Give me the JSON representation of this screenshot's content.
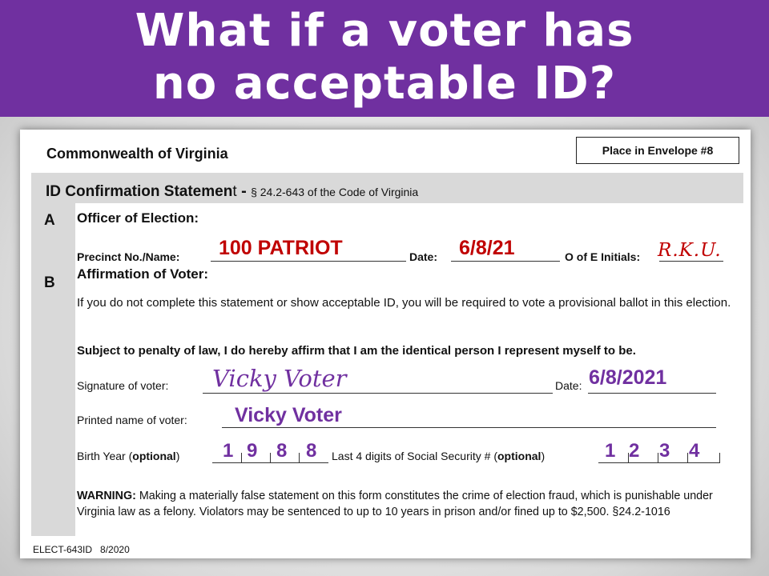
{
  "slide": {
    "title": "What if a voter has\nno acceptable ID?",
    "colors": {
      "banner": "#7030a0",
      "red_entry": "#c00000",
      "purple_entry": "#7030a0"
    }
  },
  "form": {
    "organization": "Commonwealth of Virginia",
    "envelope_label": "Place in Envelope #8",
    "statement_title": "ID Confirmation Statemen",
    "statement_title_last": "t",
    "statement_dash": " -",
    "statement_code": "§ 24.2-643 of the Code of Virginia",
    "section_a": {
      "letter": "A",
      "heading": "Officer of Election:",
      "precinct_label": "Precinct No./Name:",
      "precinct_value": "100 PATRIOT",
      "date_label": "Date:",
      "date_value": "6/8/21",
      "initials_label": "O of E Initials:",
      "initials_value": "R.K.U."
    },
    "section_b": {
      "letter": "B",
      "heading": "Affirmation of Voter:",
      "notice": "If you do not complete this statement or show acceptable ID, you will be required to vote a provisional ballot in this election.",
      "affirmation": "Subject to penalty of law, I do hereby affirm that I am the identical person I represent myself to be.",
      "signature_label": "Signature of voter:",
      "signature_value": "Vicky Voter",
      "date_label": "Date:",
      "date_value": "6/8/2021",
      "printed_name_label": "Printed name of voter:",
      "printed_name_value": "Vicky Voter",
      "birth_year_label": "Birth Year (",
      "birth_year_optional": "optional",
      "birth_year_close": ")",
      "birth_year_digits": [
        "1",
        "9",
        "8",
        "8"
      ],
      "ssn_label": "Last 4 digits of Social Security # (",
      "ssn_optional": "optional",
      "ssn_close": ")",
      "ssn_digits": [
        "1",
        "2",
        "3",
        "4"
      ],
      "warning_bold": "WARNING:",
      "warning_text": " Making a materially false statement on this form constitutes the crime of election fraud, which is punishable under Virginia law as a felony. Violators may be sentenced to up to 10 years in prison and/or fined up to $2,500. §24.2-1016"
    },
    "footer": "ELECT-643ID   8/2020"
  }
}
